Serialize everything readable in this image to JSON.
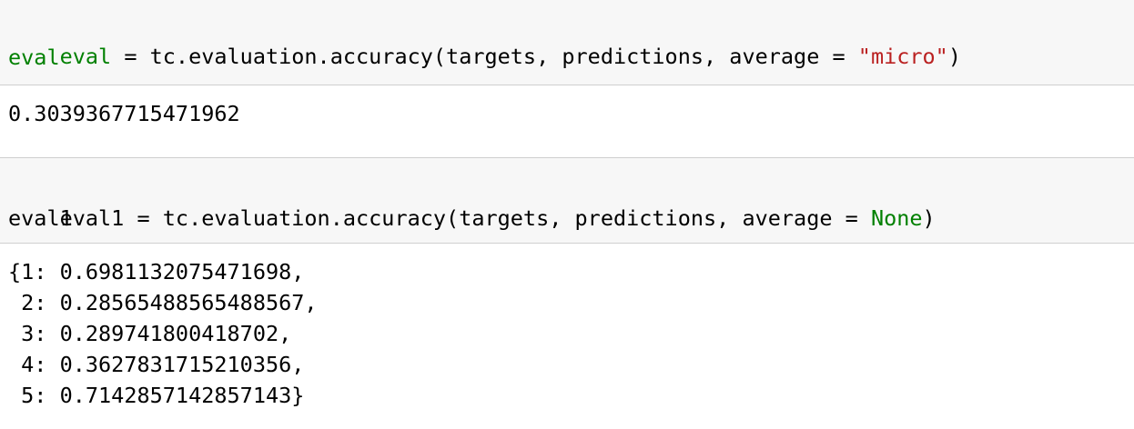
{
  "cell1": {
    "line1": {
      "var": "eval",
      "rest_before_str": " = tc.evaluation.accuracy(targets, predictions, average = ",
      "string": "\"micro\"",
      "close": ")"
    },
    "line2": "eval"
  },
  "output1": "0.3039367715471962",
  "cell2": {
    "line1": {
      "before_kw": "eval1 = tc.evaluation.accuracy(targets, predictions, average = ",
      "keyword": "None",
      "close": ")"
    },
    "line2": "eval1"
  },
  "output2": [
    "{1: 0.6981132075471698,",
    " 2: 0.28565488565488567,",
    " 3: 0.289741800418702,",
    " 4: 0.3627831715210356,",
    " 5: 0.7142857142857143}"
  ],
  "colors": {
    "cell_background": "#f7f7f7",
    "cell_border": "#cfcfcf",
    "keyword_green": "#008000",
    "string_red": "#ba2121"
  }
}
